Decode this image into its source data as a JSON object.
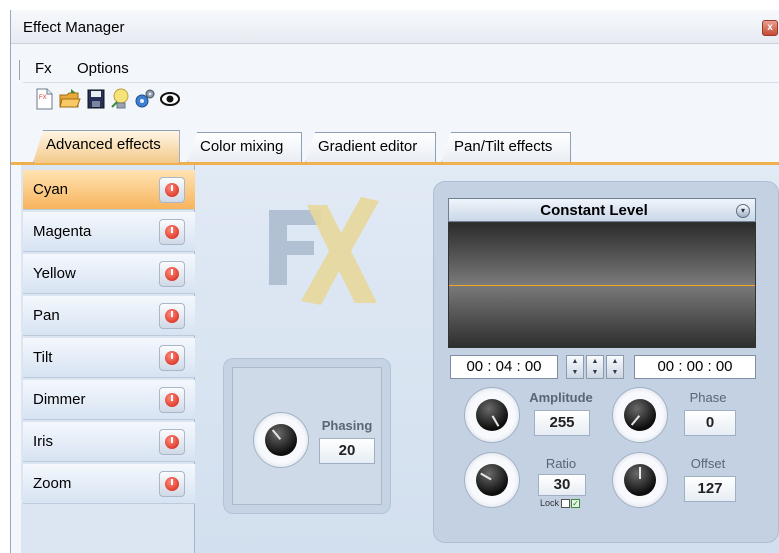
{
  "window": {
    "title": "Effect Manager",
    "close_glyph": "x"
  },
  "menu": {
    "items": [
      "Fx",
      "Options"
    ]
  },
  "toolbar": {
    "icons": [
      "new-file-icon",
      "open-folder-icon",
      "save-icon",
      "bulb-icon",
      "settings-gears-icon",
      "eye-icon"
    ]
  },
  "tabs": [
    {
      "label": "Advanced effects",
      "active": true
    },
    {
      "label": "Color mixing",
      "active": false
    },
    {
      "label": "Gradient editor",
      "active": false
    },
    {
      "label": "Pan/Tilt effects",
      "active": false
    }
  ],
  "sidebar": {
    "items": [
      {
        "label": "Cyan",
        "active": true
      },
      {
        "label": "Magenta",
        "active": false
      },
      {
        "label": "Yellow",
        "active": false
      },
      {
        "label": "Pan",
        "active": false
      },
      {
        "label": "Tilt",
        "active": false
      },
      {
        "label": "Dimmer",
        "active": false
      },
      {
        "label": "Iris",
        "active": false
      },
      {
        "label": "Zoom",
        "active": false
      }
    ]
  },
  "phasing": {
    "label": "Phasing",
    "value": "20"
  },
  "waveform": {
    "name": "Constant Level",
    "dropdown_glyph": "▾",
    "time_start": "00 : 04 : 00",
    "time_end": "00 : 00 : 00",
    "spin_up": "▲",
    "spin_down": "▼",
    "level_color": "#f5a623"
  },
  "params": {
    "amplitude": {
      "label": "Amplitude",
      "value": "255"
    },
    "phase": {
      "label": "Phase",
      "value": "0"
    },
    "ratio": {
      "label": "Ratio",
      "value": "30",
      "lock_label": "Lock"
    },
    "offset": {
      "label": "Offset",
      "value": "127"
    }
  },
  "colors": {
    "active_tab": "#f3c98a",
    "active_item": "#f7b45c",
    "power_red": "#d11e12"
  }
}
